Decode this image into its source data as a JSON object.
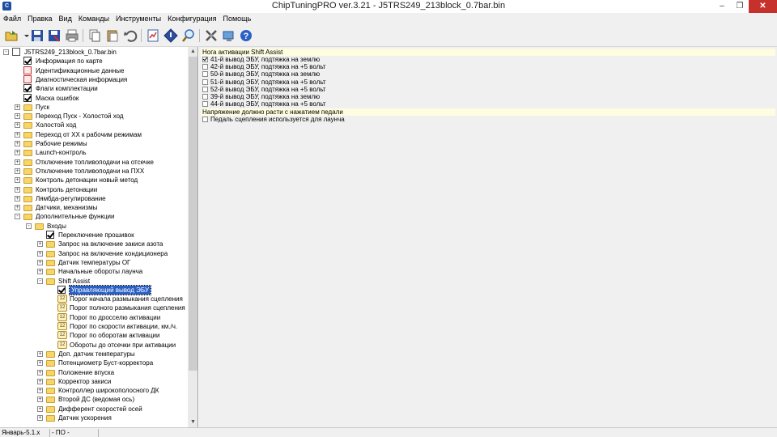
{
  "window": {
    "title": "ChipTuningPRO ver.3.21 - J5TRS249_213block_0.7bar.bin",
    "min": "–",
    "max": "❐",
    "close": "✕"
  },
  "menu": [
    "Файл",
    "Правка",
    "Вид",
    "Команды",
    "Инструменты",
    "Конфигурация",
    "Помощь"
  ],
  "toolbar": [
    "open-icon",
    "save-icon",
    "save-as-icon",
    "print-icon",
    "copy-icon",
    "paste-icon",
    "undo-icon",
    "compare-icon",
    "diamond-icon",
    "search-icon",
    "tools-icon",
    "connect-icon",
    "help-icon"
  ],
  "tree": [
    {
      "t": "J5TRS249_213block_0.7bar.bin",
      "lvl": 0,
      "icon": "doc",
      "exp": "-"
    },
    {
      "t": "Информация по карте",
      "lvl": 1,
      "icon": "check"
    },
    {
      "t": "Идентификационные данные",
      "lvl": 1,
      "icon": "docred"
    },
    {
      "t": "Диагностическая информация",
      "lvl": 1,
      "icon": "docred"
    },
    {
      "t": "Флаги комплектации",
      "lvl": 1,
      "icon": "check"
    },
    {
      "t": "Маска ошибок",
      "lvl": 1,
      "icon": "check"
    },
    {
      "t": "Пуск",
      "lvl": 1,
      "icon": "folder",
      "exp": "+"
    },
    {
      "t": "Переход Пуск - Холостой ход",
      "lvl": 1,
      "icon": "folder",
      "exp": "+"
    },
    {
      "t": "Холостой ход",
      "lvl": 1,
      "icon": "folder",
      "exp": "+"
    },
    {
      "t": "Переход от ХХ к рабочим режимам",
      "lvl": 1,
      "icon": "folder",
      "exp": "+"
    },
    {
      "t": "Рабочие режимы",
      "lvl": 1,
      "icon": "folder",
      "exp": "+"
    },
    {
      "t": "Launch-контроль",
      "lvl": 1,
      "icon": "folder",
      "exp": "+"
    },
    {
      "t": "Отключение топливоподачи на отсечке",
      "lvl": 1,
      "icon": "folder",
      "exp": "+"
    },
    {
      "t": "Отключение топливоподачи на ПХХ",
      "lvl": 1,
      "icon": "folder",
      "exp": "+"
    },
    {
      "t": "Контроль детонации новый метод",
      "lvl": 1,
      "icon": "folder",
      "exp": "+"
    },
    {
      "t": "Контроль детонации",
      "lvl": 1,
      "icon": "folder",
      "exp": "+"
    },
    {
      "t": "Лямбда-регулирование",
      "lvl": 1,
      "icon": "folder",
      "exp": "+"
    },
    {
      "t": "Датчики, механизмы",
      "lvl": 1,
      "icon": "folder",
      "exp": "+"
    },
    {
      "t": "Дополнительные функции",
      "lvl": 1,
      "icon": "folder",
      "exp": "-"
    },
    {
      "t": "Входы",
      "lvl": 2,
      "icon": "folder",
      "exp": "-"
    },
    {
      "t": "Переключение прошивок",
      "lvl": 3,
      "icon": "check"
    },
    {
      "t": "Запрос на включение закиси азота",
      "lvl": 3,
      "icon": "folder",
      "exp": "+"
    },
    {
      "t": "Запрос на включение кондиционера",
      "lvl": 3,
      "icon": "folder",
      "exp": "+"
    },
    {
      "t": "Датчик температуры ОГ",
      "lvl": 3,
      "icon": "folder",
      "exp": "+"
    },
    {
      "t": "Начальные обороты лаунча",
      "lvl": 3,
      "icon": "folder",
      "exp": "+"
    },
    {
      "t": "Shift Assist",
      "lvl": 3,
      "icon": "folder",
      "exp": "-"
    },
    {
      "t": "Управляющий вывод ЭБУ",
      "lvl": 4,
      "icon": "check",
      "sel": true
    },
    {
      "t": "Порог начала размыкания сцепления",
      "lvl": 4,
      "icon": "num"
    },
    {
      "t": "Порог полного размыкания сцепления",
      "lvl": 4,
      "icon": "num"
    },
    {
      "t": "Порог по дросселю активации",
      "lvl": 4,
      "icon": "num"
    },
    {
      "t": "Порог по скорости активации, км./ч.",
      "lvl": 4,
      "icon": "num"
    },
    {
      "t": "Порог по оборотам активации",
      "lvl": 4,
      "icon": "num"
    },
    {
      "t": "Обороты до отсечки при активации",
      "lvl": 4,
      "icon": "num"
    },
    {
      "t": "Доп. датчик температуры",
      "lvl": 3,
      "icon": "folder",
      "exp": "+"
    },
    {
      "t": "Потенциометр Буст-корректора",
      "lvl": 3,
      "icon": "folder",
      "exp": "+"
    },
    {
      "t": "Положение впуска",
      "lvl": 3,
      "icon": "folder",
      "exp": "+"
    },
    {
      "t": "Корректор закиси",
      "lvl": 3,
      "icon": "folder",
      "exp": "+"
    },
    {
      "t": "Контроллер широкополосного ДК",
      "lvl": 3,
      "icon": "folder",
      "exp": "+"
    },
    {
      "t": "Второй ДС (ведомая ось)",
      "lvl": 3,
      "icon": "folder",
      "exp": "+"
    },
    {
      "t": "Дифферент скоростей осей",
      "lvl": 3,
      "icon": "folder",
      "exp": "+"
    },
    {
      "t": "Датчик ускорения",
      "lvl": 3,
      "icon": "folder",
      "exp": "+"
    }
  ],
  "right": {
    "header1": "Нога активации Shift Assist",
    "options": [
      {
        "t": "41-й вывод ЭБУ, подтяжка на землю",
        "checked": true
      },
      {
        "t": "42-й вывод ЭБУ, подтяжка на +5 вольт",
        "checked": false
      },
      {
        "t": "50-й вывод ЭБУ, подтяжка на землю",
        "checked": false
      },
      {
        "t": "51-й вывод ЭБУ, подтяжка на +5 вольт",
        "checked": false
      },
      {
        "t": "52-й вывод ЭБУ, подтяжка на +5 вольт",
        "checked": false
      },
      {
        "t": "39-й вывод ЭБУ, подтяжка на землю",
        "checked": false
      },
      {
        "t": "44-й вывод ЭБУ, подтяжка на +5 вольт",
        "checked": false
      }
    ],
    "header2": "Напряжение должно расти с нажатием педали",
    "pedal": {
      "t": "Педаль сцепления используется для лаунча",
      "checked": false
    }
  },
  "status": [
    "Январь-5.1.x",
    "- ПО -"
  ]
}
